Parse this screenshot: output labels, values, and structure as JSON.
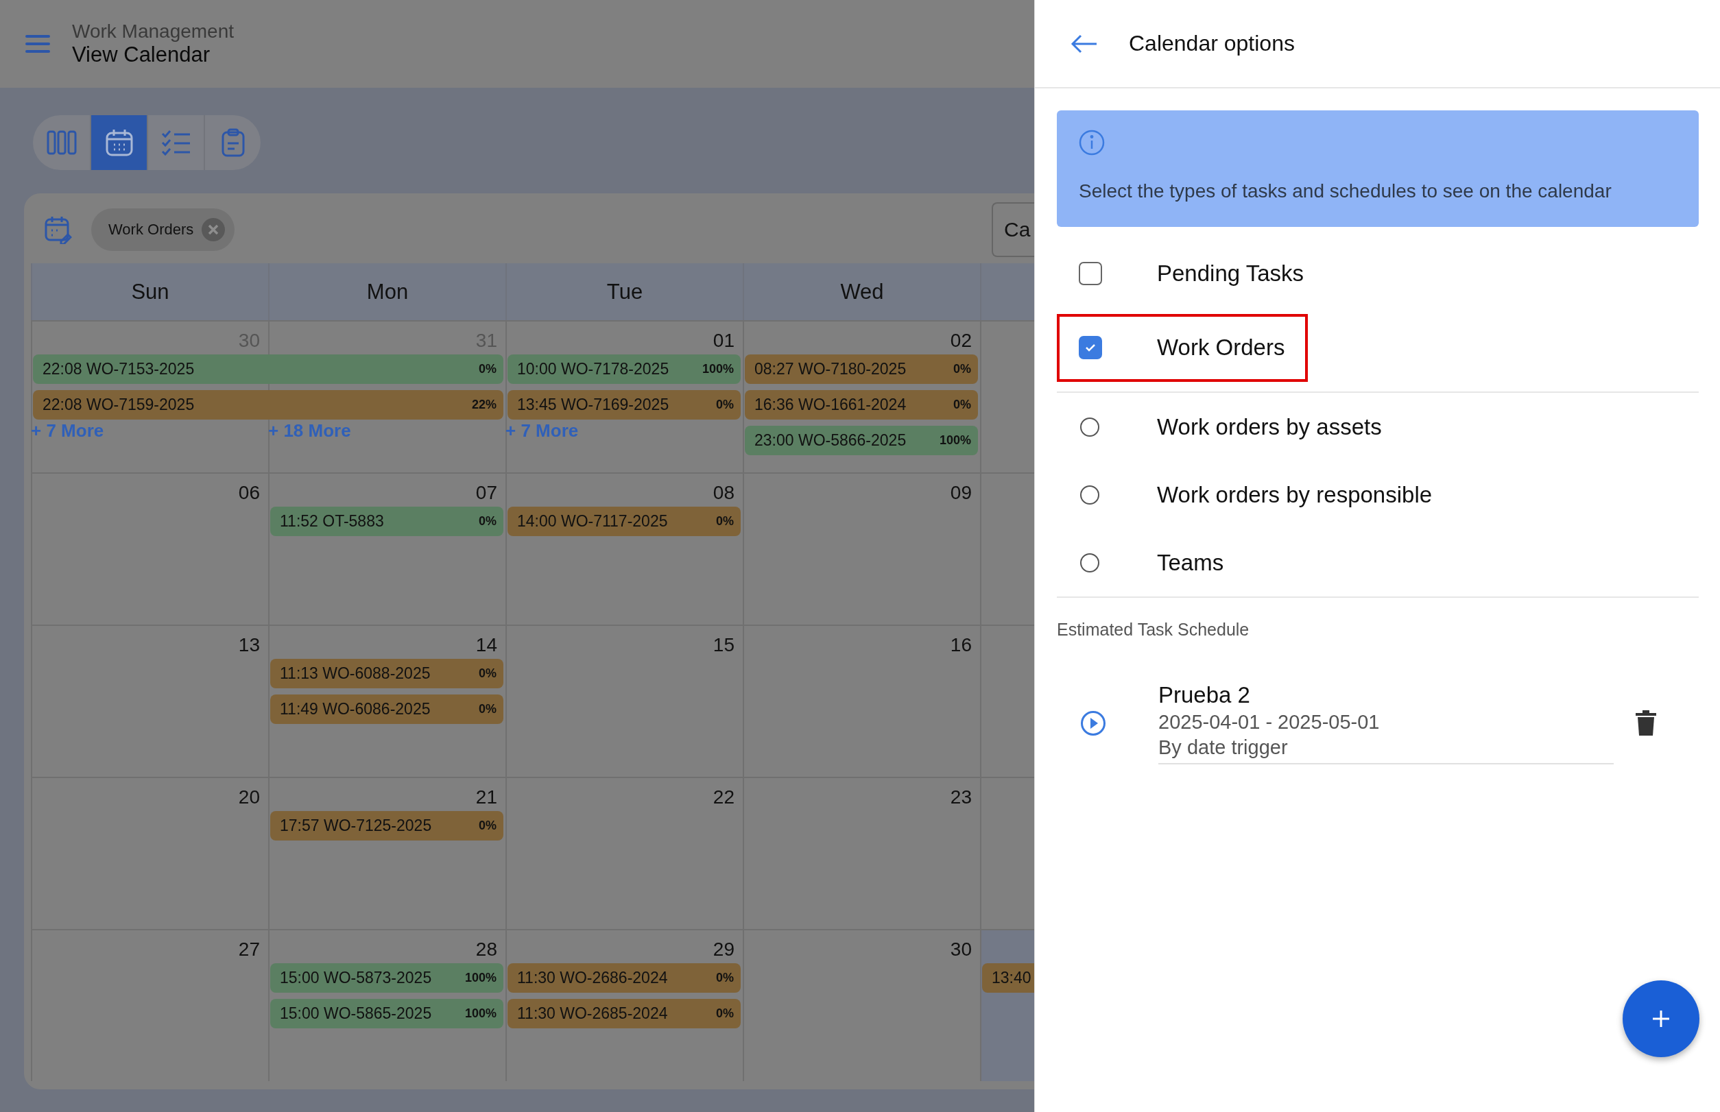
{
  "header": {
    "section": "Work Management",
    "title": "View Calendar"
  },
  "view_switcher": [
    {
      "kind": "columns",
      "selected": false
    },
    {
      "kind": "calendar",
      "selected": true
    },
    {
      "kind": "checklist",
      "selected": false
    },
    {
      "kind": "clipboard",
      "selected": false
    }
  ],
  "filters": {
    "chips": [
      {
        "label": "Work Orders"
      }
    ],
    "button": "Ca"
  },
  "calendar": {
    "weekdays": [
      "Sun",
      "Mon",
      "Tue",
      "Wed"
    ],
    "weeks": [
      {
        "days": [
          {
            "number": "30",
            "muted": true,
            "shaded": false,
            "more": "+ 7 More",
            "events": [
              {
                "text": "22:08 WO-7153-2025",
                "percent": "0%",
                "color": "#5b7f62",
                "multi_day": true
              },
              {
                "text": "22:08 WO-7159-2025",
                "percent": "22%",
                "color": "#7f6339",
                "multi_day": true
              }
            ]
          },
          {
            "number": "31",
            "muted": true,
            "shaded": false,
            "more": "+ 18 More"
          },
          {
            "number": "01",
            "muted": false,
            "shaded": false,
            "more": "+ 7 More",
            "events": [
              {
                "text": "10:00 WO-7178-2025",
                "percent": "100%",
                "color": "#5b7f62",
                "multi_day": false
              },
              {
                "text": "13:45 WO-7169-2025",
                "percent": "0%",
                "color": "#7f6339",
                "multi_day": false
              }
            ]
          },
          {
            "number": "02",
            "muted": false,
            "shaded": false,
            "events": [
              {
                "text": "08:27 WO-7180-2025",
                "percent": "0%",
                "color": "#7f6339",
                "multi_day": false
              },
              {
                "text": "16:36 WO-1661-2024",
                "percent": "0%",
                "color": "#7f6339",
                "multi_day": false
              },
              {
                "text": "23:00 WO-5866-2025",
                "percent": "100%",
                "color": "#5b7f62",
                "multi_day": false
              }
            ]
          },
          {
            "shaded": false
          }
        ]
      },
      {
        "days": [
          {
            "number": "06",
            "muted": false,
            "shaded": false
          },
          {
            "number": "07",
            "muted": false,
            "shaded": false,
            "events": [
              {
                "text": "11:52 OT-5883",
                "percent": "0%",
                "color": "#5b7f62",
                "multi_day": false
              }
            ]
          },
          {
            "number": "08",
            "muted": false,
            "shaded": false,
            "events": [
              {
                "text": "14:00 WO-7117-2025",
                "percent": "0%",
                "color": "#7f6339",
                "multi_day": false
              }
            ]
          },
          {
            "number": "09",
            "muted": false,
            "shaded": false
          },
          {
            "shaded": false
          }
        ]
      },
      {
        "days": [
          {
            "number": "13",
            "muted": false,
            "shaded": false
          },
          {
            "number": "14",
            "muted": false,
            "shaded": false,
            "events": [
              {
                "text": "11:13 WO-6088-2025",
                "percent": "0%",
                "color": "#7f6339",
                "multi_day": false
              },
              {
                "text": "11:49 WO-6086-2025",
                "percent": "0%",
                "color": "#7f6339",
                "multi_day": false
              }
            ]
          },
          {
            "number": "15",
            "muted": false,
            "shaded": false
          },
          {
            "number": "16",
            "muted": false,
            "shaded": false
          },
          {
            "shaded": false
          }
        ]
      },
      {
        "days": [
          {
            "number": "20",
            "muted": false,
            "shaded": false
          },
          {
            "number": "21",
            "muted": false,
            "shaded": false,
            "events": [
              {
                "text": "17:57 WO-7125-2025",
                "percent": "0%",
                "color": "#7f6339",
                "multi_day": false
              }
            ]
          },
          {
            "number": "22",
            "muted": false,
            "shaded": false
          },
          {
            "number": "23",
            "muted": false,
            "shaded": false
          },
          {
            "shaded": false
          }
        ]
      },
      {
        "days": [
          {
            "number": "27",
            "muted": false,
            "shaded": false
          },
          {
            "number": "28",
            "muted": false,
            "shaded": false,
            "events": [
              {
                "text": "15:00 WO-5873-2025",
                "percent": "100%",
                "color": "#5b7f62",
                "multi_day": false
              },
              {
                "text": "15:00 WO-5865-2025",
                "percent": "100%",
                "color": "#5b7f62",
                "multi_day": false
              }
            ]
          },
          {
            "number": "29",
            "muted": false,
            "shaded": false,
            "events": [
              {
                "text": "11:30 WO-2686-2024",
                "percent": "0%",
                "color": "#7f6339",
                "multi_day": false
              },
              {
                "text": "11:30 WO-2685-2024",
                "percent": "0%",
                "color": "#7f6339",
                "multi_day": false
              }
            ]
          },
          {
            "number": "30",
            "muted": false,
            "shaded": false
          },
          {
            "shaded": true,
            "events": [
              {
                "text": "13:40",
                "color": "#7f6339"
              }
            ]
          }
        ]
      }
    ]
  },
  "options_panel": {
    "title": "Calendar options",
    "info": "Select the types of tasks and schedules to see on the calendar",
    "option_groups": [
      [
        {
          "kind": "checkbox",
          "label": "Pending Tasks",
          "checked": false,
          "highlighted": false
        },
        {
          "kind": "checkbox",
          "label": "Work Orders",
          "checked": true,
          "highlighted": true
        }
      ],
      [
        {
          "kind": "radio",
          "label": "Work orders by assets",
          "selected": false,
          "highlighted": false
        },
        {
          "kind": "radio",
          "label": "Work orders by responsible",
          "selected": false,
          "highlighted": false
        },
        {
          "kind": "radio",
          "label": "Teams",
          "selected": false,
          "highlighted": false
        }
      ]
    ],
    "section_title": "Estimated Task Schedule",
    "schedules": [
      {
        "name": "Prueba 2",
        "dates": "2025-04-01 - 2025-05-01",
        "trigger": "By date trigger"
      }
    ]
  }
}
